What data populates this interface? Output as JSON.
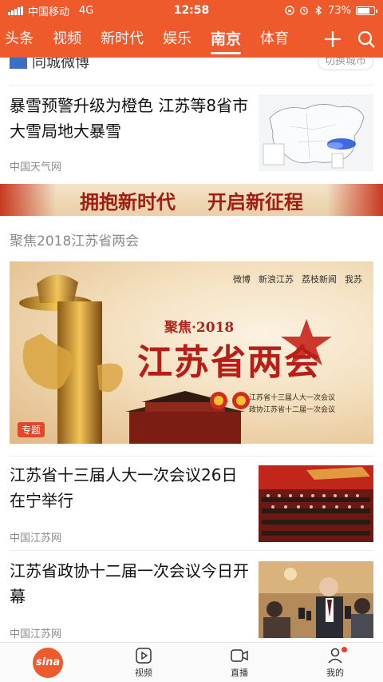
{
  "status_bar": {
    "carrier": "中国移动",
    "network": "4G",
    "time": "12:58",
    "battery_percent": "73%",
    "battery_level": 0.73
  },
  "tabs": [
    "头条",
    "视频",
    "新时代",
    "娱乐",
    "南京",
    "体育"
  ],
  "active_tab_index": 4,
  "weather_strip": {
    "city_label": "同城微博",
    "switch_city": "切换城市"
  },
  "news": [
    {
      "title": "暴雪预警升级为橙色 江苏等8省市大雪局地大暴雪",
      "source": "中国天气网"
    },
    {
      "title": "江苏省十三届人大一次会议26日在宁举行",
      "source": "中国江苏网"
    },
    {
      "title": "江苏省政协十二届一次会议今日开幕",
      "source": "中国江苏网"
    }
  ],
  "banner": {
    "left_text": "拥抱新时代",
    "right_text": "开启新征程"
  },
  "section_heading": "聚焦2018江苏省两会",
  "feature": {
    "focus_text": "聚焦·2018",
    "title": "江苏省两会",
    "sub_line1": "江苏省十三届人大一次会议",
    "sub_line2": "政协江苏省十二届一次会议",
    "badge": "专题",
    "logos": [
      "微博",
      "新浪江苏",
      "荔枝新闻",
      "我苏"
    ]
  },
  "bottom_nav": {
    "home_logo": "sina",
    "items": [
      "视频",
      "直播",
      "我的"
    ]
  },
  "colors": {
    "brand": "#ee5a2c",
    "accent_red": "#b81e16"
  }
}
